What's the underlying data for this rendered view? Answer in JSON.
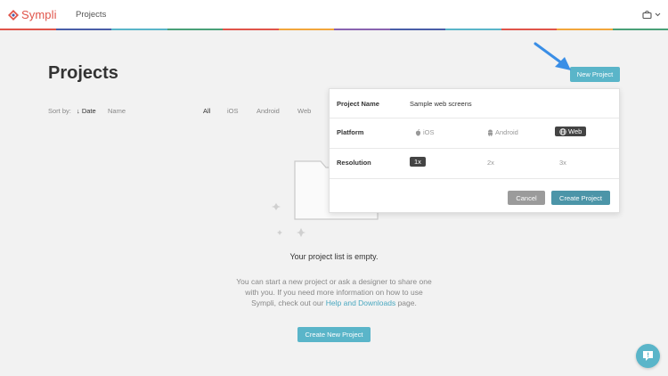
{
  "app": {
    "logo_text": "Sympli",
    "nav_projects": "Projects",
    "accent": "#5ab5c9",
    "brand": "#e0544a",
    "stripe_colors": [
      "#e0544a",
      "#4a5ea8",
      "#5ab5c9",
      "#49a078",
      "#e0544a",
      "#f2a63b",
      "#8a63b0",
      "#4a5ea8",
      "#5ab5c9",
      "#e0544a",
      "#f2a63b",
      "#49a078"
    ]
  },
  "page": {
    "title": "Projects",
    "new_project_label": "New Project"
  },
  "sortbar": {
    "sort_by_label": "Sort by:",
    "date_label": "Date",
    "name_label": "Name",
    "filters": [
      "All",
      "iOS",
      "Android",
      "Web"
    ]
  },
  "empty": {
    "title": "Your project list is empty.",
    "desc_before": "You can start a new project or ask a designer to share one with you. If you need more information on how to use Sympli, check out our ",
    "link": "Help and Downloads",
    "desc_after": " page.",
    "create_label": "Create New Project"
  },
  "popup": {
    "name_label": "Project Name",
    "name_value": "Sample web screens",
    "platform_label": "Platform",
    "platforms": [
      {
        "label": "iOS",
        "icon": "apple-icon",
        "selected": false
      },
      {
        "label": "Android",
        "icon": "android-icon",
        "selected": false
      },
      {
        "label": "Web",
        "icon": "globe-icon",
        "selected": true
      }
    ],
    "resolution_label": "Resolution",
    "resolutions": [
      {
        "label": "1x",
        "selected": true
      },
      {
        "label": "2x",
        "selected": false
      },
      {
        "label": "3x",
        "selected": false
      }
    ],
    "cancel_label": "Cancel",
    "create_label": "Create Project"
  }
}
